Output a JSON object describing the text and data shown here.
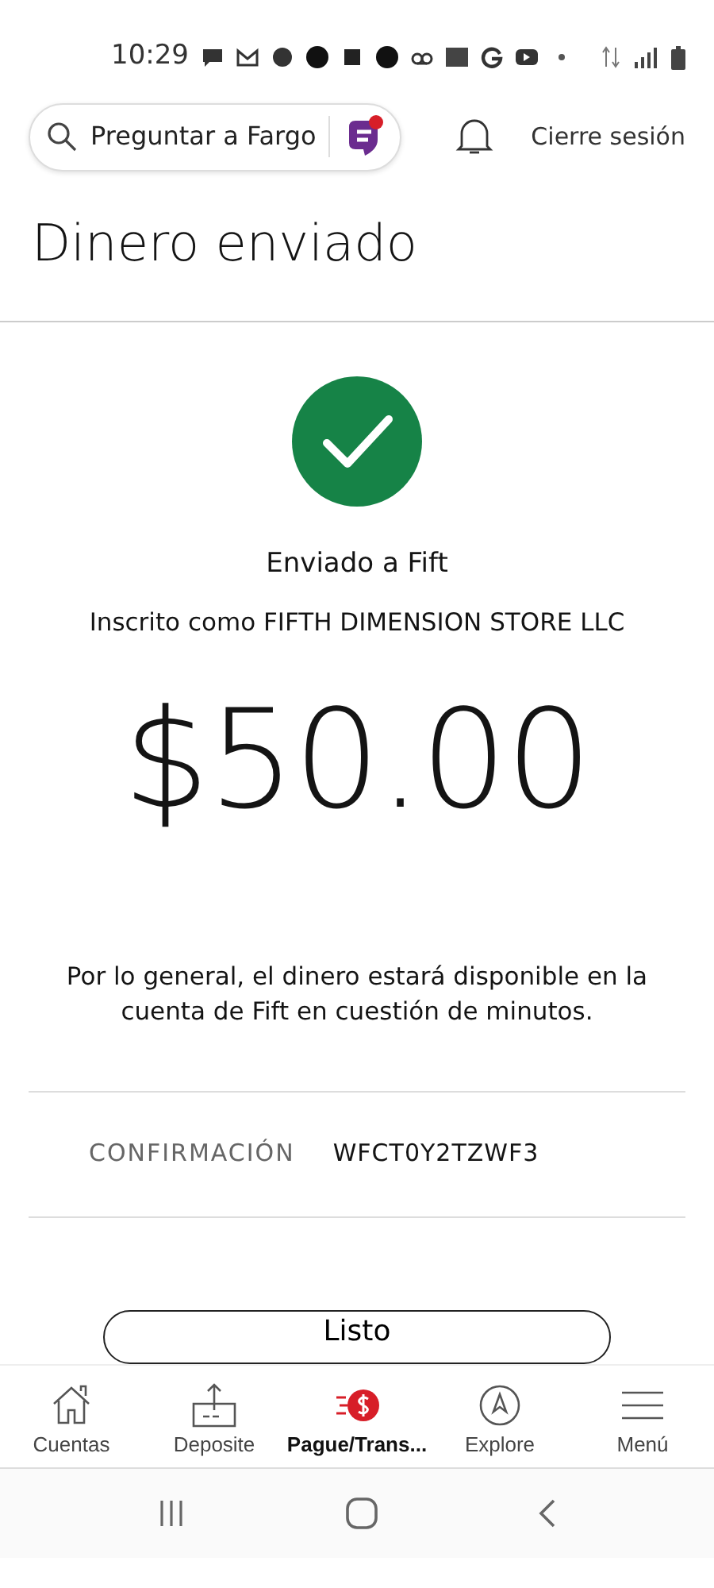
{
  "status_bar": {
    "time": "10:29"
  },
  "header": {
    "search": {
      "label": "Preguntar a Fargo",
      "badge": true
    },
    "logout": "Cierre sesión"
  },
  "title": "Dinero enviado",
  "result": {
    "heading": "Enviado a Fift",
    "enrolled": "Inscrito como FIFTH DIMENSION STORE LLC",
    "amount": "$50.00",
    "note": "Por lo general, el dinero estará disponible en la cuenta de Fift en cuestión de minutos."
  },
  "confirmation": {
    "label": "CONFIRMACIÓN",
    "value": "WFCT0Y2TZWF3"
  },
  "button": "Listo",
  "tabs": [
    {
      "label": "Cuentas",
      "kind": "home",
      "selected": false
    },
    {
      "label": "Deposite",
      "kind": "deposit",
      "selected": false
    },
    {
      "label": "Pague/Trans...",
      "kind": "pay",
      "selected": true
    },
    {
      "label": "Explore",
      "kind": "explore",
      "selected": false
    },
    {
      "label": "Menú",
      "kind": "menu",
      "selected": false
    }
  ]
}
